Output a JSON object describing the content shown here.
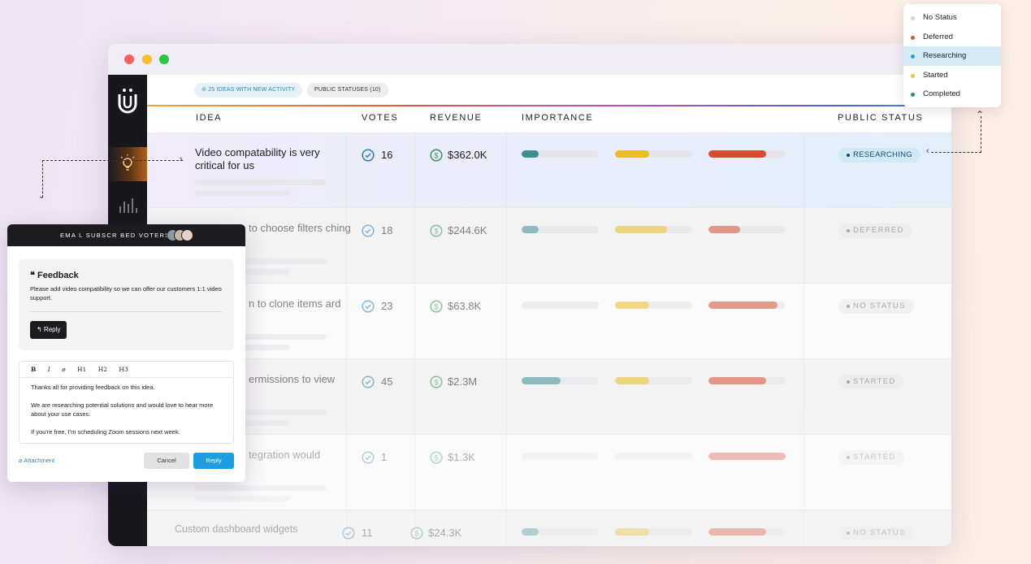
{
  "top_pills": {
    "activity": "25 IDEAS WITH NEW ACTIVITY",
    "statuses": "PUBLIC STATUSES (10)"
  },
  "columns": {
    "idea": "IDEA",
    "votes": "VOTES",
    "revenue": "REVENUE",
    "importance": "IMPORTANCE",
    "status": "PUBLIC STATUS"
  },
  "rows": [
    {
      "title": "Video compatability is very critical for us",
      "votes": "16",
      "revenue": "$362.0K",
      "status": "RESEARCHING",
      "importance": [
        0.22,
        0.44,
        0.75
      ]
    },
    {
      "title": "to choose filters ching",
      "votes": "18",
      "revenue": "$244.6K",
      "status": "DEFERRED",
      "importance": [
        0.22,
        0.67,
        0.41
      ]
    },
    {
      "title": "n to clone items ard",
      "votes": "23",
      "revenue": "$63.8K",
      "status": "NO STATUS",
      "importance": [
        0,
        0.44,
        0.89
      ]
    },
    {
      "title": "ermissions to view",
      "votes": "45",
      "revenue": "$2.3M",
      "status": "STARTED",
      "importance": [
        0.5,
        0.44,
        0.75
      ]
    },
    {
      "title": "tegration would",
      "votes": "1",
      "revenue": "$1.3K",
      "status": "STARTED",
      "importance": [
        0,
        0,
        1.0
      ]
    },
    {
      "title": "Custom dashboard widgets",
      "votes": "11",
      "revenue": "$24.3K",
      "status": "NO STATUS",
      "importance": [
        0.22,
        0.44,
        0.75
      ]
    }
  ],
  "status_menu": [
    {
      "label": "No Status",
      "color": "#d4d4d8"
    },
    {
      "label": "Deferred",
      "color": "#e4572e"
    },
    {
      "label": "Researching",
      "color": "#1e9ee0"
    },
    {
      "label": "Started",
      "color": "#f2c530"
    },
    {
      "label": "Completed",
      "color": "#2a8a82"
    }
  ],
  "popup": {
    "header": "EMA L SUBSCR BED VOTERS",
    "feedback_title": "Feedback",
    "feedback_body": "Please add video compatibility so we can offer our customers 1:1 video support.",
    "reply_label": "Reply",
    "toolbar": [
      "B",
      "I",
      "H1",
      "H2",
      "H3"
    ],
    "editor": [
      "Thanks all for providing feedback on this idea.",
      "We are researching potential solutions and would love to hear more about your use cases.",
      "If you're free, I'm scheduling Zoom sessions next week."
    ],
    "attachment": "Attachment",
    "cancel": "Cancel",
    "reply": "Reply"
  },
  "colors": {
    "imp1": "#3a8f92",
    "imp2": "#e9bd24",
    "imp3": "#d44d2f",
    "accent": "#1e9ee0"
  }
}
